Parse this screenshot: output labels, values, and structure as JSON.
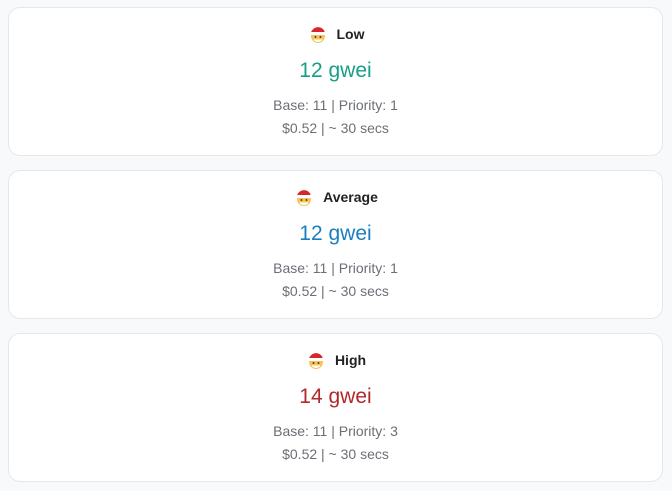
{
  "tiers": [
    {
      "icon": "santa-hat-face-icon",
      "label": "Low",
      "price": "12 gwei",
      "color": "#16a085",
      "detail": "Base: 11 | Priority: 1",
      "cost": "$0.52 | ~ 30 secs"
    },
    {
      "icon": "santa-hat-face-icon",
      "label": "Average",
      "price": "12 gwei",
      "color": "#1a7fc0",
      "detail": "Base: 11 | Priority: 1",
      "cost": "$0.52 | ~ 30 secs"
    },
    {
      "icon": "santa-hat-face-icon",
      "label": "High",
      "price": "14 gwei",
      "color": "#b2282b",
      "detail": "Base: 11 | Priority: 3",
      "cost": "$0.52 | ~ 30 secs"
    }
  ]
}
